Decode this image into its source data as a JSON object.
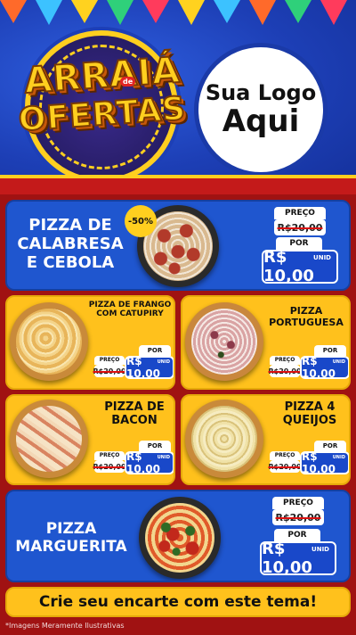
{
  "header": {
    "title_line1": "ARRAIÁ",
    "title_de": "de",
    "title_line2": "OFERTAS",
    "logo_line1": "Sua Logo",
    "logo_line2": "Aqui"
  },
  "featured_top": {
    "name": "PIZZA DE CALABRESA E CEBOLA",
    "discount": "-50%",
    "price_label": "PREÇO",
    "old_price": "R$20,00",
    "por_label": "POR",
    "new_price": "R$ 10,00",
    "unid": "UNID"
  },
  "grid": [
    {
      "name": "PIZZA DE FRANGO COM CATUPIRY",
      "price_label": "PREÇO",
      "old_price": "R$20,00",
      "por_label": "POR",
      "new_price": "R$ 10,00",
      "unid": "UNID"
    },
    {
      "name": "PIZZA PORTUGUESA",
      "price_label": "PREÇO",
      "old_price": "R$20,00",
      "por_label": "POR",
      "new_price": "R$ 10,00",
      "unid": "UNID"
    },
    {
      "name": "PIZZA DE BACON",
      "price_label": "PREÇO",
      "old_price": "R$20,00",
      "por_label": "POR",
      "new_price": "R$ 10,00",
      "unid": "UNID"
    },
    {
      "name": "PIZZA 4 QUEIJOS",
      "price_label": "PREÇO",
      "old_price": "R$20,00",
      "por_label": "POR",
      "new_price": "R$ 10,00",
      "unid": "UNID"
    }
  ],
  "featured_bottom": {
    "name": "PIZZA MARGUERITA",
    "price_label": "PREÇO",
    "old_price": "R$20,00",
    "por_label": "POR",
    "new_price": "R$ 10,00",
    "unid": "UNID"
  },
  "footer": {
    "cta": "Crie seu encarte com este tema!",
    "disclaimer": "*Imagens Meramente Ilustrativas"
  },
  "colors": {
    "background_red": "#a01212",
    "card_blue": "#1f56cf",
    "card_yellow": "#ffc11c",
    "title_gold": "#ffcf1f"
  }
}
